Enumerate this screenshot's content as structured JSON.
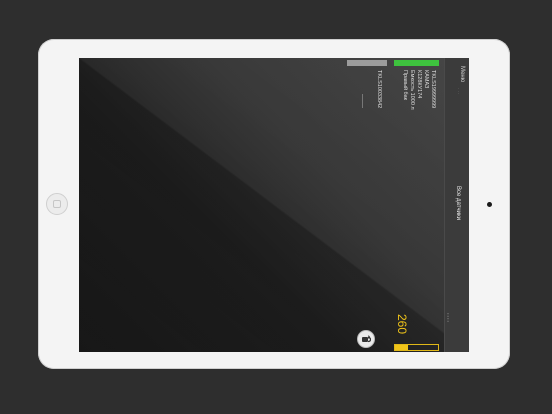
{
  "sidebar": {
    "menu_label": "Меню",
    "all_sensors_label": "Все датчики"
  },
  "devices": [
    {
      "line1": "TKLS19999999",
      "line2": "КАМАЗ",
      "line3": "К128КУ174",
      "line4": "Емкость 1000 л",
      "line5": "Правый бак",
      "status_color": "#3ec23e"
    },
    {
      "line1": "TKLS10033842",
      "status_color": "#9c9c9c"
    }
  ],
  "gauge": {
    "value": "260",
    "fill_fraction": 0.3,
    "color": "#f0c419"
  },
  "icons": {
    "lock": "lock-icon",
    "home": "home-button",
    "camera": "camera"
  }
}
